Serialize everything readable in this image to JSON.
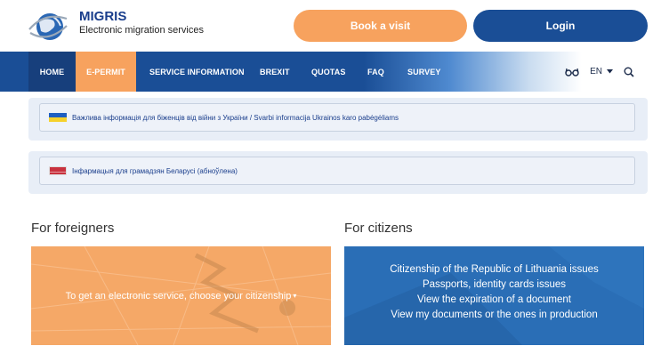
{
  "header": {
    "brand_title": "MIGRIS",
    "brand_subtitle": "Electronic migration services",
    "book_label": "Book a visit",
    "login_label": "Login"
  },
  "nav": {
    "items": [
      "HOME",
      "E-PERMIT",
      "SERVICE INFORMATION",
      "BREXIT",
      "QUOTAS",
      "FAQ",
      "SURVEY"
    ],
    "language": "EN",
    "accessibility_icon": "glasses-icon",
    "search_icon": "search-icon"
  },
  "notices": [
    {
      "text": "Важлива інформація для біженців від війни з України / Svarbi informacija Ukrainos karo pabėgėliams",
      "flag": "ukraine-flag-icon"
    },
    {
      "text": "Інфармацыя для грамадзян Беларусі (абноўлена)",
      "flag": "belarus-flag-icon"
    }
  ],
  "sections": {
    "foreigners": {
      "title": "For foreigners",
      "text": "To get an electronic service, choose your citizenship"
    },
    "citizens": {
      "title": "For citizens",
      "links": [
        "Citizenship of the Republic of Lithuania issues",
        "Passports, identity cards issues",
        "View the expiration of a document",
        "View my documents or the ones in production"
      ]
    }
  },
  "colors": {
    "primary_blue": "#1a4e96",
    "accent_orange": "#f7a25e",
    "notice_bg": "#e8eef7"
  }
}
